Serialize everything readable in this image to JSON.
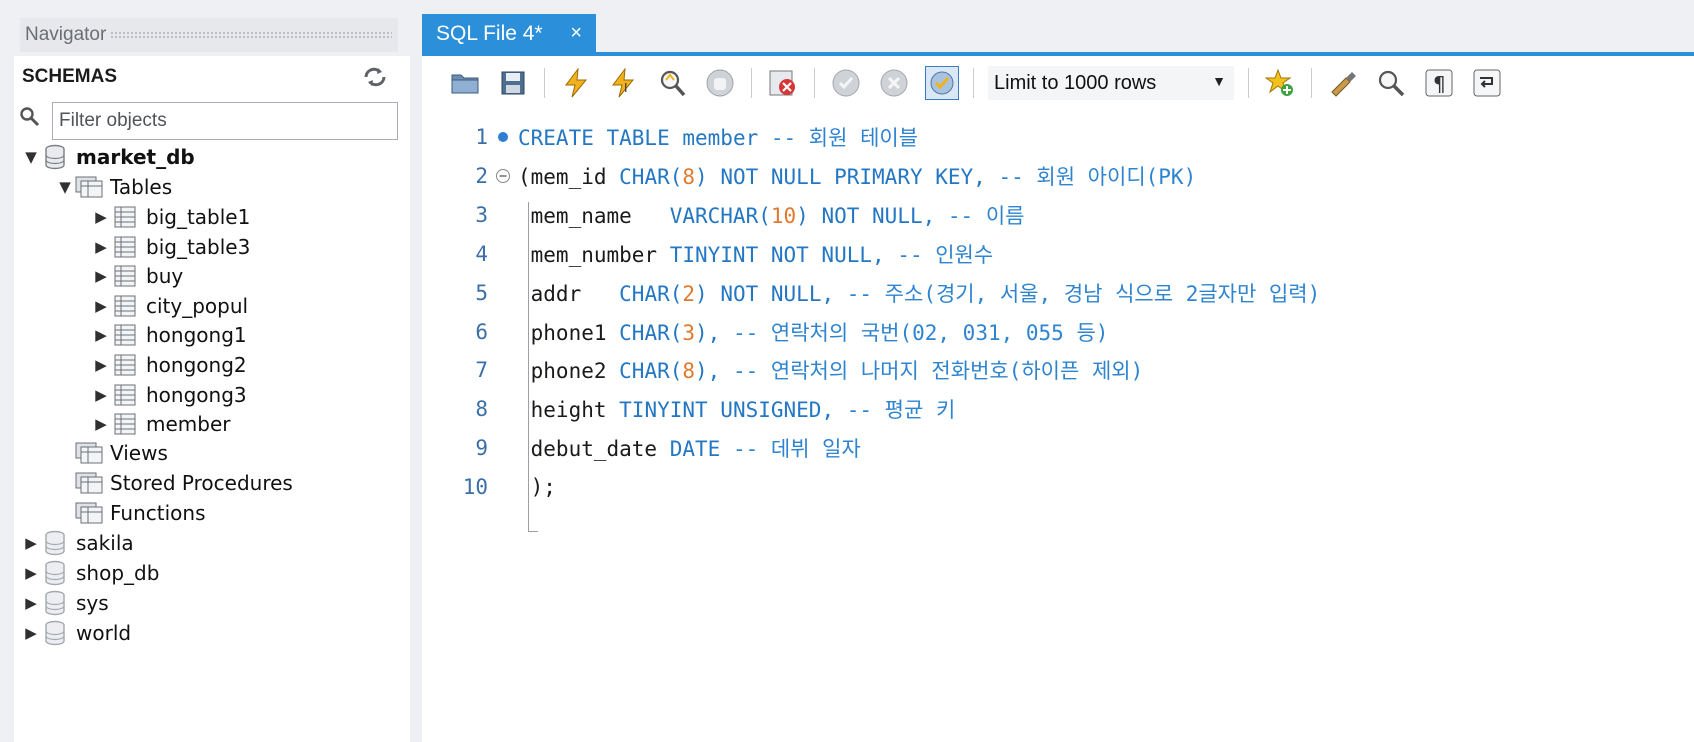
{
  "navigator": {
    "title": "Navigator",
    "schemas_label": "SCHEMAS",
    "filter_placeholder": "Filter objects",
    "tree": {
      "market_db": "market_db",
      "tables": "Tables",
      "table_items": [
        "big_table1",
        "big_table3",
        "buy",
        "city_popul",
        "hongong1",
        "hongong2",
        "hongong3",
        "member"
      ],
      "views": "Views",
      "stored_procedures": "Stored Procedures",
      "functions": "Functions",
      "other_schemas": [
        "sakila",
        "shop_db",
        "sys",
        "world"
      ]
    }
  },
  "tab": {
    "label": "SQL File 4*",
    "close": "×"
  },
  "toolbar": {
    "limit_value": "Limit to 1000 rows",
    "icons": [
      "open-folder-icon",
      "save-icon",
      "execute-icon",
      "execute-current-icon",
      "explain-icon",
      "stop-icon",
      "toggle-error-icon",
      "commit-icon",
      "rollback-icon",
      "autocommit-icon",
      "bookmark-icon",
      "beautify-icon",
      "find-icon",
      "invisible-chars-icon",
      "wrap-icon"
    ]
  },
  "editor": {
    "line_numbers": [
      "1",
      "2",
      "3",
      "4",
      "5",
      "6",
      "7",
      "8",
      "9",
      "10"
    ],
    "lines": [
      [
        {
          "t": "CREATE TABLE",
          "c": "kw"
        },
        {
          "t": " ",
          "c": "txt"
        },
        {
          "t": "member",
          "c": "kw"
        },
        {
          "t": " -- 회원 테이블",
          "c": "cm"
        }
      ],
      [
        {
          "t": "(mem_id ",
          "c": "txt"
        },
        {
          "t": "CHAR(",
          "c": "kw"
        },
        {
          "t": "8",
          "c": "num"
        },
        {
          "t": ") NOT NULL PRIMARY KEY,",
          "c": "kw"
        },
        {
          "t": " -- 회원 아이디(PK)",
          "c": "cm"
        }
      ],
      [
        {
          "t": " mem_name   ",
          "c": "txt"
        },
        {
          "t": "VARCHAR(",
          "c": "kw"
        },
        {
          "t": "10",
          "c": "num"
        },
        {
          "t": ") NOT NULL,",
          "c": "kw"
        },
        {
          "t": " -- 이름",
          "c": "cm"
        }
      ],
      [
        {
          "t": " mem_number ",
          "c": "txt"
        },
        {
          "t": "TINYINT NOT NULL,",
          "c": "kw"
        },
        {
          "t": " -- 인원수",
          "c": "cm"
        }
      ],
      [
        {
          "t": " addr   ",
          "c": "txt"
        },
        {
          "t": "CHAR(",
          "c": "kw"
        },
        {
          "t": "2",
          "c": "num"
        },
        {
          "t": ") NOT NULL,",
          "c": "kw"
        },
        {
          "t": " -- 주소(경기, 서울, 경남 식으로 2글자만 입력)",
          "c": "cm"
        }
      ],
      [
        {
          "t": " phone1 ",
          "c": "txt"
        },
        {
          "t": "CHAR(",
          "c": "kw"
        },
        {
          "t": "3",
          "c": "num"
        },
        {
          "t": "),",
          "c": "kw"
        },
        {
          "t": " -- 연락처의 국번(02, 031, 055 등)",
          "c": "cm"
        }
      ],
      [
        {
          "t": " phone2 ",
          "c": "txt"
        },
        {
          "t": "CHAR(",
          "c": "kw"
        },
        {
          "t": "8",
          "c": "num"
        },
        {
          "t": "),",
          "c": "kw"
        },
        {
          "t": " -- 연락처의 나머지 전화번호(하이픈 제외)",
          "c": "cm"
        }
      ],
      [
        {
          "t": " height ",
          "c": "txt"
        },
        {
          "t": "TINYINT UNSIGNED,",
          "c": "kw"
        },
        {
          "t": " -- 평균 키",
          "c": "cm"
        }
      ],
      [
        {
          "t": " debut_date ",
          "c": "txt"
        },
        {
          "t": "DATE",
          "c": "kw"
        },
        {
          "t": " -- 데뷔 일자",
          "c": "cm"
        }
      ],
      [
        {
          "t": " );",
          "c": "txt"
        }
      ]
    ]
  },
  "colors": {
    "accent": "#2b8fd9",
    "keyword": "#2477c3",
    "number": "#e07a2e",
    "comment": "#2f84d0"
  }
}
